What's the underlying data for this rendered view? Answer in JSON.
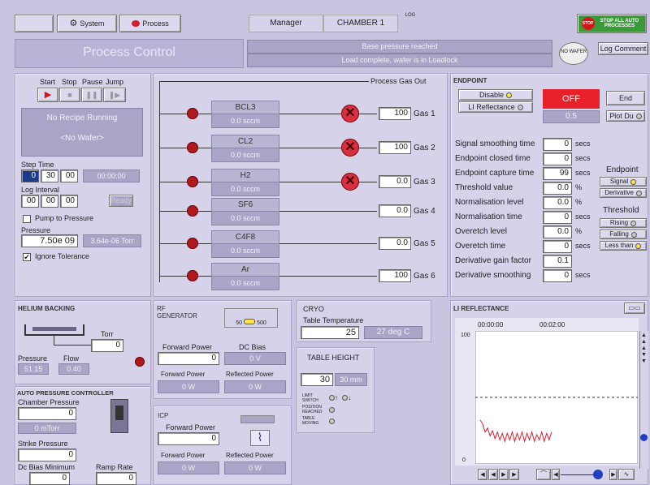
{
  "toolbar": {
    "system": "System",
    "process": "Process",
    "manager": "Manager",
    "chamber": "CHAMBER 1",
    "log": "LOG",
    "stop_all": "STOP ALL AUTO PROCESSES",
    "stop_badge": "STOP"
  },
  "title": "Process Control",
  "status": {
    "line1": "Base pressure reached",
    "line2": "Load complete, wafer is in Loadlock",
    "wafer": "NO WAFER",
    "log_comment": "Log Comment"
  },
  "recipe": {
    "start": "Start",
    "stop": "Stop",
    "pause": "Pause",
    "jump": "Jump",
    "no_recipe": "No Recipe Running",
    "no_wafer": "<No Wafer>",
    "step_time": "Step Time",
    "step_h": "0",
    "step_m": "30",
    "step_s": "00",
    "step_elapsed": "00:00:00",
    "log_interval": "Log Interval",
    "log_h": "00",
    "log_m": "00",
    "log_s": "00",
    "ready": "Ready",
    "pump": "Pump to Pressure",
    "pressure_label": "Pressure",
    "pressure_value": "7.50e 09",
    "pressure_read": "3.64e-06 Torr",
    "ignore": "Ignore Tolerance"
  },
  "gas": {
    "process_out": "Process Gas Out",
    "lines": [
      {
        "name": "BCL3",
        "flow": "0.0 sccm",
        "setpoint": "100",
        "label": "Gas 1"
      },
      {
        "name": "CL2",
        "flow": "0.0 sccm",
        "setpoint": "100",
        "label": "Gas 2"
      },
      {
        "name": "H2",
        "flow": "0.0 sccm",
        "setpoint": "0.0",
        "label": "Gas 3"
      },
      {
        "name": "SF6",
        "flow": "0.0 sccm",
        "setpoint": "0.0",
        "label": "Gas 4"
      },
      {
        "name": "C4F8",
        "flow": "0.0 sccm",
        "setpoint": "0.0",
        "label": "Gas 5"
      },
      {
        "name": "Ar",
        "flow": "0.0 sccm",
        "setpoint": "100",
        "label": "Gas 6"
      }
    ]
  },
  "endpoint": {
    "title": "ENDPOINT",
    "disable": "Disable",
    "li_reflectance": "LI Reflectance",
    "state": "OFF",
    "value": "0.5",
    "end": "End",
    "plot": "Plot Du",
    "params": [
      {
        "label": "Signal smoothing time",
        "value": "0",
        "unit": "secs"
      },
      {
        "label": "Endpoint closed time",
        "value": "0",
        "unit": "secs"
      },
      {
        "label": "Endpoint capture time",
        "value": "99",
        "unit": "secs"
      },
      {
        "label": "Threshold value",
        "value": "0.0",
        "unit": "%"
      },
      {
        "label": "Normalisation level",
        "value": "0.0",
        "unit": "%"
      },
      {
        "label": "Normalisation time",
        "value": "0",
        "unit": "secs"
      },
      {
        "label": "Overetch level",
        "value": "0.0",
        "unit": "%"
      },
      {
        "label": "Overetch time",
        "value": "0",
        "unit": "secs"
      },
      {
        "label": "Derivative gain factor",
        "value": "0.1",
        "unit": ""
      },
      {
        "label": "Derivative smoothing",
        "value": "0",
        "unit": "secs"
      }
    ],
    "side_title": "Endpoint",
    "signal": "Signal",
    "derivative": "Derivative",
    "threshold": "Threshold",
    "rising": "Rising",
    "falling": "Falling",
    "less_than": "Less than"
  },
  "helium": {
    "title": "HELIUM BACKING",
    "torr": "Torr",
    "torr_value": "0",
    "pressure": "Pressure",
    "flow": "Flow",
    "pressure_value": "51.15",
    "flow_value": "0.40"
  },
  "apc": {
    "title": "AUTO PRESSURE CONTROLLER",
    "chamber_pressure": "Chamber Pressure",
    "cp_value": "0",
    "cp_read": "0 mTorr",
    "strike": "Strike Pressure",
    "strike_value": "0",
    "dc_min": "Dc Bias Minimum",
    "dc_min_value": "0",
    "ramp": "Ramp Rate",
    "ramp_value": "0"
  },
  "rf": {
    "title": "RF GENERATOR",
    "sw50": "50",
    "sw500": "500",
    "forward": "Forward Power",
    "dc_bias": "DC Bias",
    "forward_value": "0",
    "dc_value": "0 V",
    "forward2": "Forward Power",
    "reflected": "Reflected Power",
    "fw_read": "0 W",
    "rf_read": "0 W"
  },
  "icp": {
    "title": "ICP",
    "forward": "Forward Power",
    "forward_value": "0",
    "forward2": "Forward Power",
    "reflected": "Reflected Power",
    "fw_read": "0 W",
    "rf_read": "0 W"
  },
  "cryo": {
    "title": "CRYO",
    "table_temp": "Table Temperature",
    "temp_set": "25",
    "temp_read": "27 deg C"
  },
  "table": {
    "title": "TABLE HEIGHT",
    "height_set": "30",
    "height_read": "30 mm",
    "limit": "LIMIT SWITCH",
    "position": "POSITION REACHED",
    "moving": "TABLE MOVING"
  },
  "li": {
    "title": "LI REFLECTANCE",
    "t0": "00:00:00",
    "t1": "00:02:00",
    "y_top": "100",
    "y_bottom": "0"
  },
  "chart_data": {
    "type": "line",
    "x": [
      0,
      1,
      2,
      3,
      4,
      5,
      6,
      7,
      8,
      9,
      10,
      11,
      12,
      13,
      14,
      15,
      16,
      17,
      18,
      19,
      20,
      21,
      22,
      23,
      24,
      25,
      26,
      27,
      28,
      29
    ],
    "values": [
      33,
      30,
      24,
      27,
      21,
      25,
      19,
      24,
      18,
      23,
      17,
      23,
      18,
      24,
      17,
      23,
      18,
      24,
      17,
      23,
      18,
      24,
      17,
      22,
      18,
      24,
      17,
      23,
      18,
      24
    ],
    "ylim": [
      0,
      100
    ],
    "title": "LI REFLECTANCE",
    "threshold_line": 50
  }
}
